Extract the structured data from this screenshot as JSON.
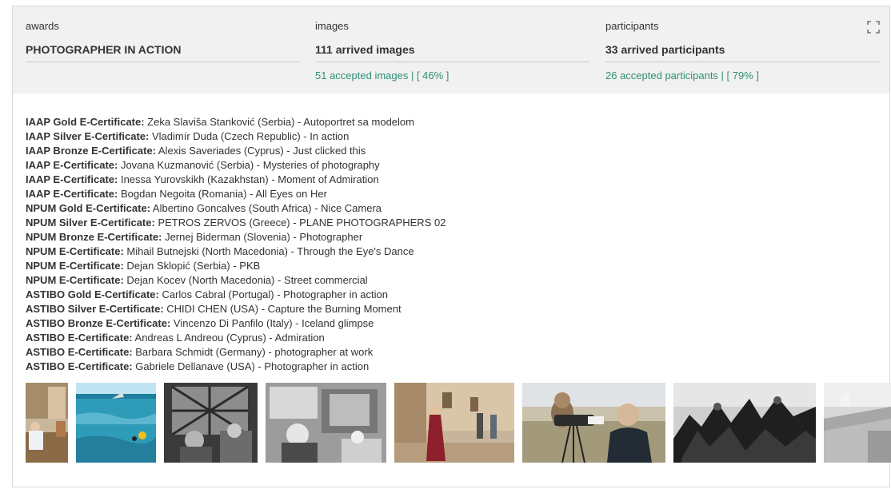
{
  "header": {
    "awards": {
      "label": "awards",
      "value": "PHOTOGRAPHER IN ACTION"
    },
    "images": {
      "label": "images",
      "value": "111 arrived images",
      "sub": "51 accepted images | [ 46% ]"
    },
    "participants": {
      "label": "participants",
      "value": "33 arrived participants",
      "sub": "26 accepted participants | [ 79% ]"
    },
    "expand_icon": "fullscreen-expand-icon"
  },
  "results": [
    {
      "award": "IAAP Gold E-Certificate:",
      "detail": " Zeka Slaviša Stanković (Serbia) - Autoportret sa modelom"
    },
    {
      "award": "IAAP Silver E-Certificate:",
      "detail": " Vladimír Duda (Czech Republic) - In action"
    },
    {
      "award": "IAAP Bronze E-Certificate:",
      "detail": " Alexis Saveriades (Cyprus) - Just clicked this"
    },
    {
      "award": "IAAP E-Certificate:",
      "detail": " Jovana Kuzmanović (Serbia) - Mysteries of photography"
    },
    {
      "award": "IAAP E-Certificate:",
      "detail": " Inessa Yurovskikh (Kazakhstan) - Moment of Admiration"
    },
    {
      "award": "IAAP E-Certificate:",
      "detail": " Bogdan Negoita (Romania) - All Eyes on Her"
    },
    {
      "award": "NPUM Gold E-Certificate:",
      "detail": " Albertino Goncalves (South Africa) - Nice Camera"
    },
    {
      "award": "NPUM Silver E-Certificate:",
      "detail": " PETROS ZERVOS (Greece) - PLANE PHOTOGRAPHERS 02"
    },
    {
      "award": "NPUM Bronze E-Certificate:",
      "detail": " Jernej Biderman (Slovenia) - Photographer"
    },
    {
      "award": "NPUM E-Certificate:",
      "detail": " Mihail Butnejski (North Macedonia) - Through the Eye's Dance"
    },
    {
      "award": "NPUM E-Certificate:",
      "detail": " Dejan Sklopić (Serbia) - PKB"
    },
    {
      "award": "NPUM E-Certificate:",
      "detail": " Dejan Kocev (North Macedonia) - Street commercial"
    },
    {
      "award": "ASTIBO Gold E-Certificate:",
      "detail": " Carlos Cabral (Portugal) - Photographer in action"
    },
    {
      "award": "ASTIBO Silver E-Certificate:",
      "detail": " CHIDI CHEN (USA) - Capture the Burning Moment"
    },
    {
      "award": "ASTIBO Bronze E-Certificate:",
      "detail": " Vincenzo Di Panfilo (Italy) - Iceland glimpse"
    },
    {
      "award": "ASTIBO E-Certificate:",
      "detail": " Andreas L Andreou (Cyprus) - Admiration"
    },
    {
      "award": "ASTIBO E-Certificate:",
      "detail": " Barbara Schmidt (Germany) - photographer at work"
    },
    {
      "award": "ASTIBO E-Certificate:",
      "detail": " Gabriele Dellanave (USA) - Photographer in action"
    }
  ],
  "colors": {
    "header_bg": "#f1f1f1",
    "accent_green": "#2f8f74",
    "text": "#333333",
    "border": "#d8d8d8"
  }
}
